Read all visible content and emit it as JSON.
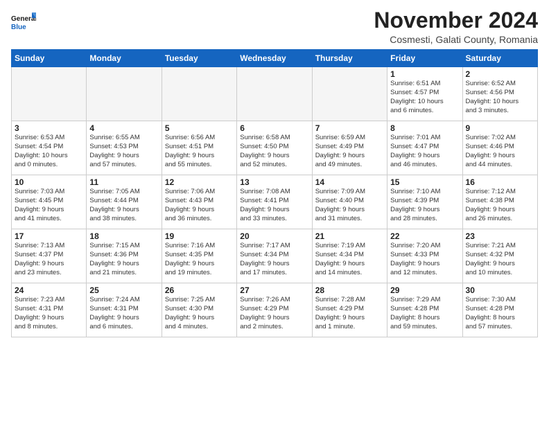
{
  "header": {
    "logo_general": "General",
    "logo_blue": "Blue",
    "month_title": "November 2024",
    "location": "Cosmesti, Galati County, Romania"
  },
  "calendar": {
    "weekdays": [
      "Sunday",
      "Monday",
      "Tuesday",
      "Wednesday",
      "Thursday",
      "Friday",
      "Saturday"
    ],
    "weeks": [
      [
        {
          "day": "",
          "info": ""
        },
        {
          "day": "",
          "info": ""
        },
        {
          "day": "",
          "info": ""
        },
        {
          "day": "",
          "info": ""
        },
        {
          "day": "",
          "info": ""
        },
        {
          "day": "1",
          "info": "Sunrise: 6:51 AM\nSunset: 4:57 PM\nDaylight: 10 hours\nand 6 minutes."
        },
        {
          "day": "2",
          "info": "Sunrise: 6:52 AM\nSunset: 4:56 PM\nDaylight: 10 hours\nand 3 minutes."
        }
      ],
      [
        {
          "day": "3",
          "info": "Sunrise: 6:53 AM\nSunset: 4:54 PM\nDaylight: 10 hours\nand 0 minutes."
        },
        {
          "day": "4",
          "info": "Sunrise: 6:55 AM\nSunset: 4:53 PM\nDaylight: 9 hours\nand 57 minutes."
        },
        {
          "day": "5",
          "info": "Sunrise: 6:56 AM\nSunset: 4:51 PM\nDaylight: 9 hours\nand 55 minutes."
        },
        {
          "day": "6",
          "info": "Sunrise: 6:58 AM\nSunset: 4:50 PM\nDaylight: 9 hours\nand 52 minutes."
        },
        {
          "day": "7",
          "info": "Sunrise: 6:59 AM\nSunset: 4:49 PM\nDaylight: 9 hours\nand 49 minutes."
        },
        {
          "day": "8",
          "info": "Sunrise: 7:01 AM\nSunset: 4:47 PM\nDaylight: 9 hours\nand 46 minutes."
        },
        {
          "day": "9",
          "info": "Sunrise: 7:02 AM\nSunset: 4:46 PM\nDaylight: 9 hours\nand 44 minutes."
        }
      ],
      [
        {
          "day": "10",
          "info": "Sunrise: 7:03 AM\nSunset: 4:45 PM\nDaylight: 9 hours\nand 41 minutes."
        },
        {
          "day": "11",
          "info": "Sunrise: 7:05 AM\nSunset: 4:44 PM\nDaylight: 9 hours\nand 38 minutes."
        },
        {
          "day": "12",
          "info": "Sunrise: 7:06 AM\nSunset: 4:43 PM\nDaylight: 9 hours\nand 36 minutes."
        },
        {
          "day": "13",
          "info": "Sunrise: 7:08 AM\nSunset: 4:41 PM\nDaylight: 9 hours\nand 33 minutes."
        },
        {
          "day": "14",
          "info": "Sunrise: 7:09 AM\nSunset: 4:40 PM\nDaylight: 9 hours\nand 31 minutes."
        },
        {
          "day": "15",
          "info": "Sunrise: 7:10 AM\nSunset: 4:39 PM\nDaylight: 9 hours\nand 28 minutes."
        },
        {
          "day": "16",
          "info": "Sunrise: 7:12 AM\nSunset: 4:38 PM\nDaylight: 9 hours\nand 26 minutes."
        }
      ],
      [
        {
          "day": "17",
          "info": "Sunrise: 7:13 AM\nSunset: 4:37 PM\nDaylight: 9 hours\nand 23 minutes."
        },
        {
          "day": "18",
          "info": "Sunrise: 7:15 AM\nSunset: 4:36 PM\nDaylight: 9 hours\nand 21 minutes."
        },
        {
          "day": "19",
          "info": "Sunrise: 7:16 AM\nSunset: 4:35 PM\nDaylight: 9 hours\nand 19 minutes."
        },
        {
          "day": "20",
          "info": "Sunrise: 7:17 AM\nSunset: 4:34 PM\nDaylight: 9 hours\nand 17 minutes."
        },
        {
          "day": "21",
          "info": "Sunrise: 7:19 AM\nSunset: 4:34 PM\nDaylight: 9 hours\nand 14 minutes."
        },
        {
          "day": "22",
          "info": "Sunrise: 7:20 AM\nSunset: 4:33 PM\nDaylight: 9 hours\nand 12 minutes."
        },
        {
          "day": "23",
          "info": "Sunrise: 7:21 AM\nSunset: 4:32 PM\nDaylight: 9 hours\nand 10 minutes."
        }
      ],
      [
        {
          "day": "24",
          "info": "Sunrise: 7:23 AM\nSunset: 4:31 PM\nDaylight: 9 hours\nand 8 minutes."
        },
        {
          "day": "25",
          "info": "Sunrise: 7:24 AM\nSunset: 4:31 PM\nDaylight: 9 hours\nand 6 minutes."
        },
        {
          "day": "26",
          "info": "Sunrise: 7:25 AM\nSunset: 4:30 PM\nDaylight: 9 hours\nand 4 minutes."
        },
        {
          "day": "27",
          "info": "Sunrise: 7:26 AM\nSunset: 4:29 PM\nDaylight: 9 hours\nand 2 minutes."
        },
        {
          "day": "28",
          "info": "Sunrise: 7:28 AM\nSunset: 4:29 PM\nDaylight: 9 hours\nand 1 minute."
        },
        {
          "day": "29",
          "info": "Sunrise: 7:29 AM\nSunset: 4:28 PM\nDaylight: 8 hours\nand 59 minutes."
        },
        {
          "day": "30",
          "info": "Sunrise: 7:30 AM\nSunset: 4:28 PM\nDaylight: 8 hours\nand 57 minutes."
        }
      ]
    ]
  }
}
